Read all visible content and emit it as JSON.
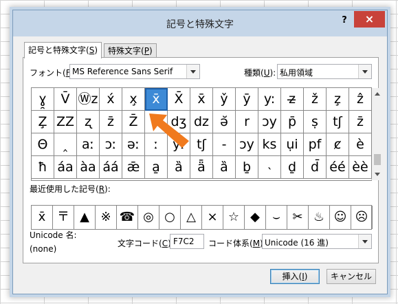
{
  "dialog": {
    "title": "記号と特殊文字",
    "help": "?",
    "close": "×"
  },
  "tabs": [
    {
      "label": "記号と特殊文字(S)",
      "text": "記号と特殊文字(",
      "key": "S",
      "end": ")"
    },
    {
      "label": "特殊文字(P)",
      "text": "特殊文字(",
      "key": "P",
      "end": ")"
    }
  ],
  "font": {
    "label_text": "フォント(",
    "key": "F",
    "end": "):",
    "value": "MS Reference Sans Serif"
  },
  "subset": {
    "label_text": "種類(",
    "key": "U",
    "end": "):",
    "value": "私用領域"
  },
  "grid": {
    "rows": [
      [
        "ɣ̯",
        "V̄",
        "Ⓦz",
        "x́",
        "x̧",
        "x̄",
        "X̄",
        "x̄",
        "y̌",
        "ȳ",
        "y:",
        "z̶",
        "ž",
        "z̧",
        "ẑ"
      ],
      [
        "Z̧",
        "ZZ",
        "ʐ",
        "z̄",
        "Z̄",
        "z̊",
        "dʒ",
        "dz",
        "ǝ̆",
        "r",
        "ɔy",
        "p̄",
        "ṣ",
        "tʃ",
        "z̄"
      ],
      [
        "Θ",
        "‸",
        "aː",
        "ɔː",
        "əː",
        "ː",
        "yː",
        "tʃ",
        "-",
        "ɔy",
        "ks",
        "ụi",
        "pf",
        "ȼ",
        "è",
        "ə"
      ],
      [
        "ħ",
        "áa",
        "àa",
        "áá",
        "ǣ",
        "a̱",
        "ȁ",
        "ǟ",
        "ȁ",
        "ḇ",
        "˴",
        "ḏ",
        "d̄",
        "éé",
        "èè"
      ]
    ],
    "selected": {
      "row": 0,
      "col": 5,
      "char": "x̄"
    }
  },
  "recent": {
    "label_text": "最近使用した記号(",
    "key": "R",
    "end": "):",
    "items": [
      "x̄",
      "〒",
      "▲",
      "※",
      "☎",
      "◎",
      "○",
      "△",
      "×",
      "☆",
      "◆",
      "⌣",
      "✂",
      "♨",
      "☺",
      "☹"
    ]
  },
  "unicode_name": {
    "label": "Unicode 名:",
    "value": "(none)"
  },
  "char_code": {
    "label_text": "文字コード(",
    "key": "C",
    "end": "):",
    "value": "F7C2"
  },
  "code_system": {
    "label_text": "コード体系(",
    "key": "M",
    "end": "):",
    "value": "Unicode (16 進)"
  },
  "buttons": {
    "insert": {
      "text": "挿入(",
      "key": "I",
      "end": ")"
    },
    "cancel": "キャンセル"
  },
  "colors": {
    "selection": "#3d8ad6",
    "close": "#c8423a",
    "arrow": "#f07a1e"
  }
}
